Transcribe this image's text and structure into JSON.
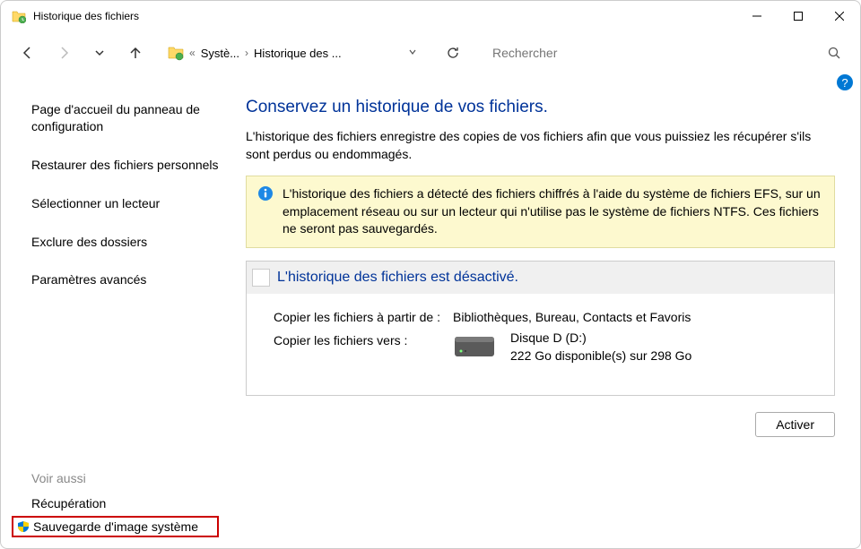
{
  "window": {
    "title": "Historique des fichiers"
  },
  "breadcrumb": {
    "prefix": "«",
    "item1": "Systè...",
    "item2": "Historique des ..."
  },
  "search": {
    "placeholder": "Rechercher"
  },
  "sidebar": {
    "home": "Page d'accueil du panneau de configuration",
    "restore": "Restaurer des fichiers personnels",
    "select_drive": "Sélectionner un lecteur",
    "exclude": "Exclure des dossiers",
    "advanced": "Paramètres avancés"
  },
  "see_also": {
    "header": "Voir aussi",
    "recovery": "Récupération",
    "system_image": "Sauvegarde d'image système"
  },
  "main": {
    "title": "Conservez un historique de vos fichiers.",
    "description": "L'historique des fichiers enregistre des copies de vos fichiers afin que vous puissiez les récupérer s'ils sont perdus ou endommagés.",
    "info": "L'historique des fichiers a détecté des fichiers chiffrés à l'aide du système de fichiers EFS, sur un emplacement réseau ou sur un lecteur qui n'utilise pas le système de fichiers NTFS. Ces fichiers ne seront pas sauvegardés.",
    "status_title": "L'historique des fichiers est désactivé.",
    "copy_from_label": "Copier les fichiers à partir de :",
    "copy_from_value": "Bibliothèques, Bureau, Contacts et Favoris",
    "copy_to_label": "Copier les fichiers vers :",
    "disk_name": "Disque D (D:)",
    "disk_space": "222 Go disponible(s) sur 298 Go",
    "activate": "Activer"
  }
}
